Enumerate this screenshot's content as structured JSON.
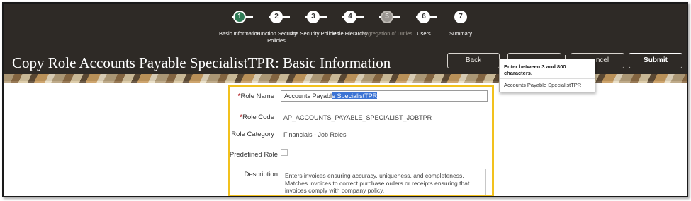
{
  "train": {
    "steps": [
      {
        "number": "1",
        "label": "Basic Information",
        "state": "active"
      },
      {
        "number": "2",
        "label": "Function Security Policies",
        "state": "normal"
      },
      {
        "number": "3",
        "label": "Data Security Policies",
        "state": "normal"
      },
      {
        "number": "4",
        "label": "Role Hierarchy",
        "state": "normal"
      },
      {
        "number": "5",
        "label": "Segregation of Duties",
        "state": "disabled"
      },
      {
        "number": "6",
        "label": "Users",
        "state": "normal"
      },
      {
        "number": "7",
        "label": "Summary",
        "state": "normal"
      }
    ]
  },
  "header": {
    "title": "Copy Role Accounts Payable SpecialistTPR: Basic Information",
    "back_label": "Back",
    "next_label": "",
    "cancel_label": "ncel",
    "submit_label": "Submit"
  },
  "tooltip": {
    "heading": "Enter between 3 and 800 characters.",
    "value": "Accounts Payable SpecialistTPR"
  },
  "form": {
    "role_name_required": "*",
    "role_name_label": "Role Name",
    "role_name_value_plain": "Accounts Payabl",
    "role_name_value_selected": "e SpecialistTPR",
    "role_code_required": "*",
    "role_code_label": "Role Code",
    "role_code_value": "AP_ACCOUNTS_PAYABLE_SPECIALIST_JOBTPR",
    "role_category_label": "Role Category",
    "role_category_value": "Financials - Job Roles",
    "predefined_role_label": "Predefined Role",
    "description_label": "Description",
    "description_value": "Enters invoices ensuring accuracy, uniqueness, and completeness. Matches invoices to correct purchase orders or receipts ensuring that invoices comply with company policy."
  },
  "colors": {
    "header_bg": "#2e2a26",
    "active_step": "#2f7a55",
    "highlight_border": "#f2c11d",
    "selection": "#3c74d4",
    "required": "#b01f24"
  }
}
